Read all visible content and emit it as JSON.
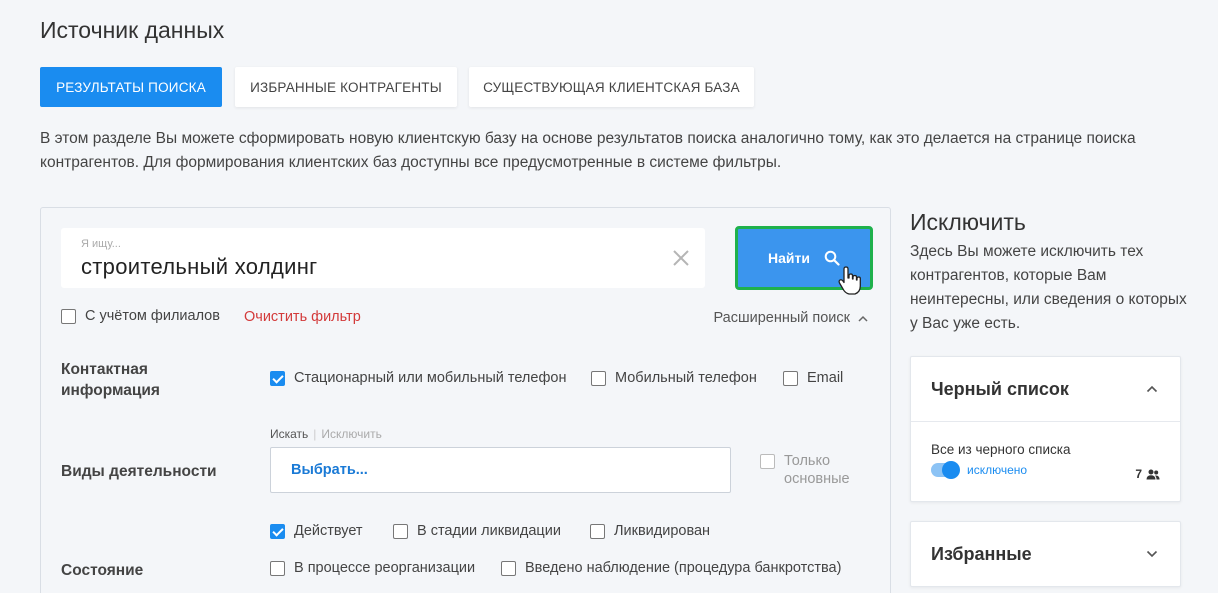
{
  "page": {
    "title": "Источник данных"
  },
  "tabs": [
    {
      "label": "РЕЗУЛЬТАТЫ ПОИСКА",
      "active": true
    },
    {
      "label": "ИЗБРАННЫЕ КОНТРАГЕНТЫ",
      "active": false
    },
    {
      "label": "СУЩЕСТВУЮЩАЯ КЛИЕНТСКАЯ БАЗА",
      "active": false
    }
  ],
  "intro": "В этом разделе Вы можете сформировать новую клиентскую базу на основе результатов поиска аналогично тому, как это делается на странице поиска контрагентов. Для формирования клиентских баз доступны все предусмотренные в системе фильтры.",
  "search": {
    "placeholder": "Я ищу...",
    "value": "строительный холдинг",
    "button_label": "Найти"
  },
  "filters": {
    "branches_label": "С учётом филиалов",
    "branches_checked": false,
    "clear_label": "Очистить фильтр",
    "advanced_label": "Расширенный поиск"
  },
  "contact": {
    "label": "Контактная информация",
    "options": [
      {
        "label": "Стационарный или мобильный телефон",
        "checked": true
      },
      {
        "label": "Мобильный телефон",
        "checked": false
      },
      {
        "label": "Email",
        "checked": false
      }
    ]
  },
  "activities": {
    "label": "Виды деятельности",
    "mode_search": "Искать",
    "mode_exclude": "Исключить",
    "select_label": "Выбрать...",
    "only_main_label": "Только основные"
  },
  "status": {
    "label": "Состояние",
    "options": [
      {
        "label": "Действует",
        "checked": true
      },
      {
        "label": "В стадии ликвидации",
        "checked": false
      },
      {
        "label": "Ликвидирован",
        "checked": false
      },
      {
        "label": "В процессе реорганизации",
        "checked": false
      },
      {
        "label": "Введено наблюдение (процедура банкротства)",
        "checked": false
      }
    ]
  },
  "exclude": {
    "title": "Исключить",
    "text": "Здесь Вы можете исключить тех контрагентов, которые Вам неинтересны, или сведения о которых у Вас уже есть.",
    "blacklist": {
      "title": "Черный список",
      "item_label": "Все из черного списка",
      "toggle_label": "исключено",
      "count": "7"
    },
    "favorites": {
      "title": "Избранные"
    }
  },
  "colors": {
    "accent": "#1a8cf0",
    "highlight": "#1fb14c",
    "danger": "#d33a3a"
  }
}
